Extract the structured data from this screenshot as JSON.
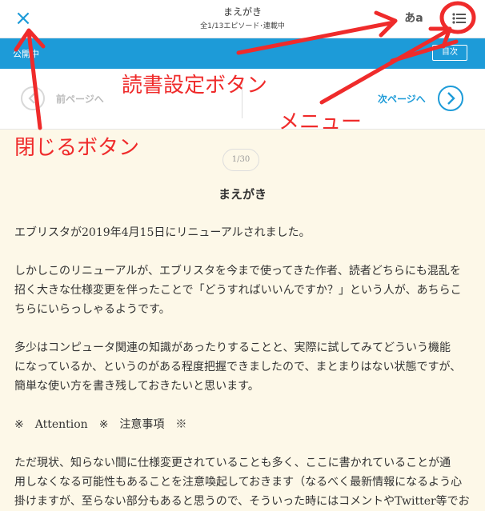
{
  "header": {
    "close_icon": "×",
    "title": "まえがき",
    "subtitle": "全1/13エピソード･連載中",
    "font_setting_label": "あa",
    "menu_icon_name": "list-menu-icon"
  },
  "blue_bar": {
    "left_text": "公開中",
    "right_button": "目次"
  },
  "nav": {
    "prev_label": "前ページへ",
    "next_label": "次ページへ"
  },
  "content": {
    "page_counter": "1/30",
    "chapter_title": "まえがき",
    "paragraphs": [
      [
        "エブリスタが2019年4月15日にリニューアルされました。"
      ],
      [
        "しかしこのリニューアルが、エブリスタを今まで使ってきた作者、読者どちらにも混乱を",
        "招く大きな仕様変更を伴ったことで「どうすればいいんですか？」という人が、あちらこ",
        "ちらにいらっしゃるようです。"
      ],
      [
        "多少はコンピュータ関連の知識があったりすることと、実際に試してみてどういう機能",
        "になっているか、というのがある程度把握できましたので、まとまりはない状態ですが、",
        "簡単な使い方を書き残しておきたいと思います。"
      ],
      [
        "※　Attention　※　注意事項　※"
      ],
      [
        "ただ現状、知らない間に仕様変更されていることも多く、ここに書かれていることが通",
        "用しなくなる可能性もあることを注意喚起しておきます（なるべく最新情報になるよう心",
        "掛けますが、至らない部分もあると思うので、そういった時にはコメントやTwitter等でお"
      ]
    ]
  },
  "annotations": {
    "settings": "読書設定ボタン",
    "menu": "メニュー",
    "close": "閉じるボタン"
  },
  "colors": {
    "accent": "#1d9bd8",
    "annotation": "#ef2b2b",
    "page_bg": "#fdf8e8"
  }
}
